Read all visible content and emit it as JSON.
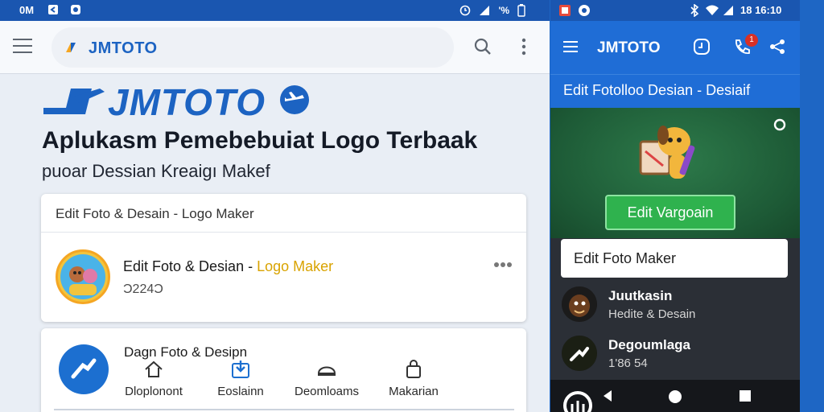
{
  "left_status": {
    "time": "0M",
    "battery": "'%"
  },
  "left_topbar": {
    "brand": "JMTOTO"
  },
  "left_hero": {
    "brand_name": "JMTOTO",
    "headline": "Aplukasm Pemebebuiat Logo Terbaak",
    "subline": "puoar  Dessian Kreaigı Makef"
  },
  "card_app": {
    "header": "Edit Foto & Desain  - Logo Maker",
    "title_main": "Edit Foto & Desian - ",
    "title_highlight": "Logo Maker",
    "subtitle": "Ͻ224Ͻ"
  },
  "card_nav": {
    "title": "Dagn Foto & Desipn",
    "items": [
      {
        "label": "Dloplonont",
        "icon": "home-icon"
      },
      {
        "label": "Eoslainn",
        "icon": "download-icon"
      },
      {
        "label": "Deomloams",
        "icon": "hat-icon"
      },
      {
        "label": "Makarian",
        "icon": "bag-icon"
      }
    ]
  },
  "right_status": {
    "time": "18 16:10"
  },
  "right_topbar": {
    "brand": "JMTOTO",
    "badge_count": "1"
  },
  "right_subbar": {
    "title": "Edit Fotolloo Desian - Desiaif"
  },
  "promo": {
    "button_label": "Edit Vargoain"
  },
  "edit_field": {
    "value": "Edit Foto Maker"
  },
  "right_list": [
    {
      "title": "Juutkasin",
      "subtitle": "Hedite & Desain"
    },
    {
      "title": "Degoumlaga",
      "subtitle": "1'86 54"
    }
  ],
  "colors": {
    "primary_blue": "#1c63c2",
    "appbar_blue": "#1f6dd6",
    "promo_green": "#2fb24e",
    "highlight_gold": "#d9a300"
  }
}
